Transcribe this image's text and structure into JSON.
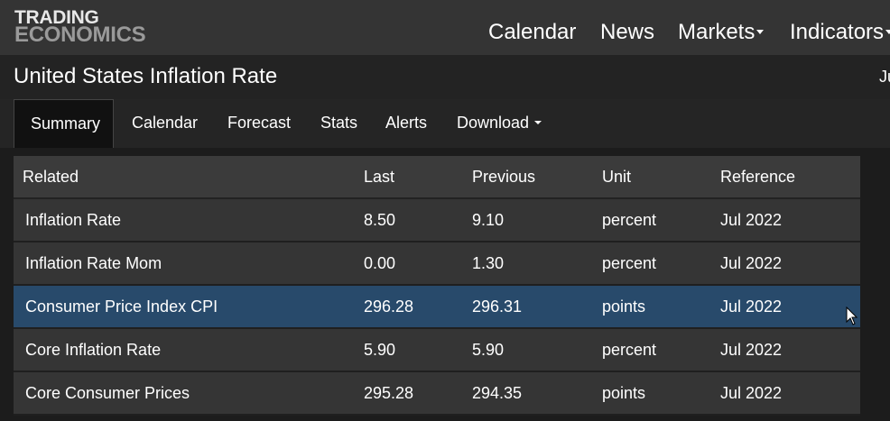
{
  "logo": {
    "line1": "TRADING",
    "line2": "ECONOMICS"
  },
  "nav": [
    {
      "label": "Calendar"
    },
    {
      "label": "News"
    },
    {
      "label": "Markets"
    },
    {
      "label": "Indicators"
    }
  ],
  "page": {
    "title": "United States Inflation Rate",
    "right_text": "Ju"
  },
  "tabs": [
    {
      "label": "Summary"
    },
    {
      "label": "Calendar"
    },
    {
      "label": "Forecast"
    },
    {
      "label": "Stats"
    },
    {
      "label": "Alerts"
    },
    {
      "label": "Download"
    }
  ],
  "table": {
    "headers": [
      "Related",
      "Last",
      "Previous",
      "Unit",
      "Reference"
    ],
    "rows": [
      [
        "Inflation Rate",
        "8.50",
        "9.10",
        "percent",
        "Jul 2022"
      ],
      [
        "Inflation Rate Mom",
        "0.00",
        "1.30",
        "percent",
        "Jul 2022"
      ],
      [
        "Consumer Price Index CPI",
        "296.28",
        "296.31",
        "points",
        "Jul 2022"
      ],
      [
        "Core Inflation Rate",
        "5.90",
        "5.90",
        "percent",
        "Jul 2022"
      ],
      [
        "Core Consumer Prices",
        "295.28",
        "294.35",
        "points",
        "Jul 2022"
      ]
    ]
  },
  "colors": {
    "highlight_row": "#284a6b",
    "header_bg": "#3b3b3b",
    "row_bg": "#353535"
  }
}
